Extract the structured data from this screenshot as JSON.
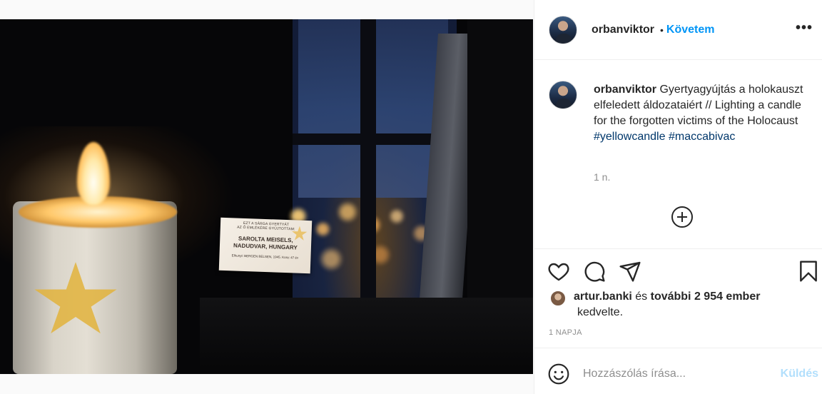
{
  "post": {
    "username": "orbanviktor",
    "follow_dot": "•",
    "follow_label": "Követem",
    "more_label": "•••"
  },
  "caption": {
    "username": "orbanviktor",
    "text": "Gyertyagyújtás a holokauszt elfeledett áldozataiért // Lighting a candle for the forgotten victims of the Holocaust",
    "hashtags": [
      "#yellowcandle",
      "#maccabivac"
    ],
    "time": "1 n."
  },
  "photo": {
    "card_line1": "EZT A SÁRGA GYERTYÁT",
    "card_line2": "AZ Ő EMLÉKÉRE GYÚJTOTTAM:",
    "card_name1": "SAROLTA MEISELS,",
    "card_name2": "NADUDVAR, HUNGARY",
    "card_footer": "Elhunyt: BERGEN BELSEN, 1945. Kora: 47 év"
  },
  "likes": {
    "liker": "artur.banki",
    "conj": " és ",
    "others": "további 2 954 ember",
    "suffix": "kedvelte."
  },
  "ago": "1 NAPJA",
  "comment": {
    "placeholder": "Hozzászólás írása...",
    "send_label": "Küldés"
  },
  "icons": [
    "heart-icon",
    "comment-icon",
    "share-icon",
    "bookmark-icon",
    "plus-circle-icon",
    "emoji-icon",
    "more-icon"
  ]
}
